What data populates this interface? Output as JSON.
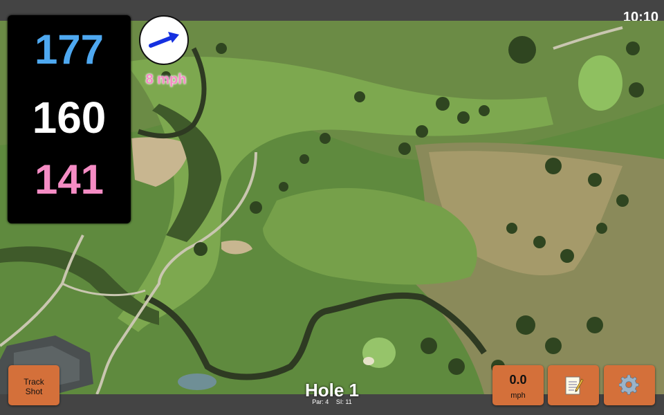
{
  "status_bar": {
    "time": "10:10"
  },
  "distances": {
    "back": "177",
    "middle": "160",
    "front": "141"
  },
  "wind": {
    "speed": "8 mph",
    "direction_icon": "arrow-icon"
  },
  "buttons": {
    "track_shot_line1": "Track",
    "track_shot_line2": "Shot",
    "speed_value": "0.0",
    "speed_unit": "mph",
    "notes_icon": "notepad-icon",
    "settings_icon": "gear-icon"
  },
  "hole": {
    "title": "Hole 1",
    "par": "Par: 4",
    "si": "SI: 11"
  },
  "colors": {
    "back_distance": "#4ea8f0",
    "middle_distance": "#ffffff",
    "front_distance": "#f58cc4",
    "button": "#d4703a"
  }
}
